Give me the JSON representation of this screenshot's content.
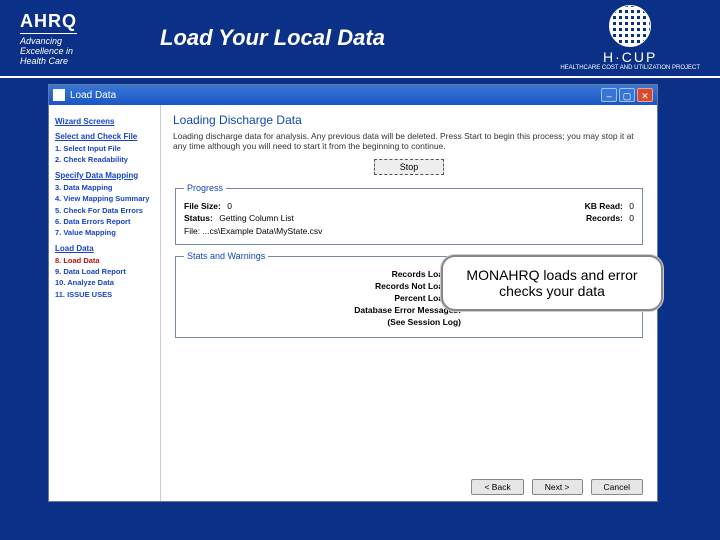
{
  "header": {
    "ahrq_logo_text": "AHRQ",
    "tagline_l1": "Advancing",
    "tagline_l2": "Excellence in",
    "tagline_l3": "Health Care",
    "title": "Load Your Local Data",
    "hcup_text": "H·CUP",
    "hcup_sub": "HEALTHCARE COST AND UTILIZATION PROJECT"
  },
  "window": {
    "title": "Load Data"
  },
  "sidebar": {
    "groups": [
      {
        "head": "Wizard Screens"
      },
      {
        "head": "Select and Check File",
        "steps": [
          "1. Select Input File",
          "2. Check Readability"
        ]
      },
      {
        "head": "Specify Data Mapping",
        "steps": [
          "3. Data Mapping",
          "4. View Mapping Summary",
          "5. Check For Data Errors",
          "6. Data Errors Report",
          "7. Value Mapping"
        ]
      },
      {
        "head": "Load Data",
        "steps": [
          "8. Load Data",
          "9. Data Load Report",
          "10. Analyze Data",
          "11. ISSUE USES"
        ],
        "current_index": 0
      }
    ]
  },
  "main": {
    "heading": "Loading Discharge Data",
    "intro": "Loading discharge data for analysis. Any previous data will be deleted. Press Start to begin this process; you may stop it at any time although you will need to start it from the beginning to continue.",
    "stop_label": "Stop",
    "progress": {
      "legend": "Progress",
      "file_size_label": "File Size:",
      "file_size_value": "0",
      "kb_read_label": "KB Read:",
      "kb_read_value": "0",
      "status_label": "Status:",
      "status_value": "Getting Column List",
      "records_label": "Records:",
      "records_value": "0",
      "file_label": "File:",
      "file_value": "...cs\\Example Data\\MyState.csv"
    },
    "stats": {
      "legend": "Stats and Warnings",
      "rows": [
        {
          "label": "Records Loaded:",
          "value": "-"
        },
        {
          "label": "Records Not Loaded:",
          "value": "-"
        },
        {
          "label": "Percent Loaded:",
          "value": "-"
        },
        {
          "label": "Database Error Messages:",
          "value": "-"
        },
        {
          "label": "(See Session Log)",
          "value": ""
        }
      ]
    }
  },
  "callout": "MONAHRQ loads and error checks your data",
  "footer": {
    "back": "< Back",
    "next": "Next >",
    "cancel": "Cancel"
  }
}
